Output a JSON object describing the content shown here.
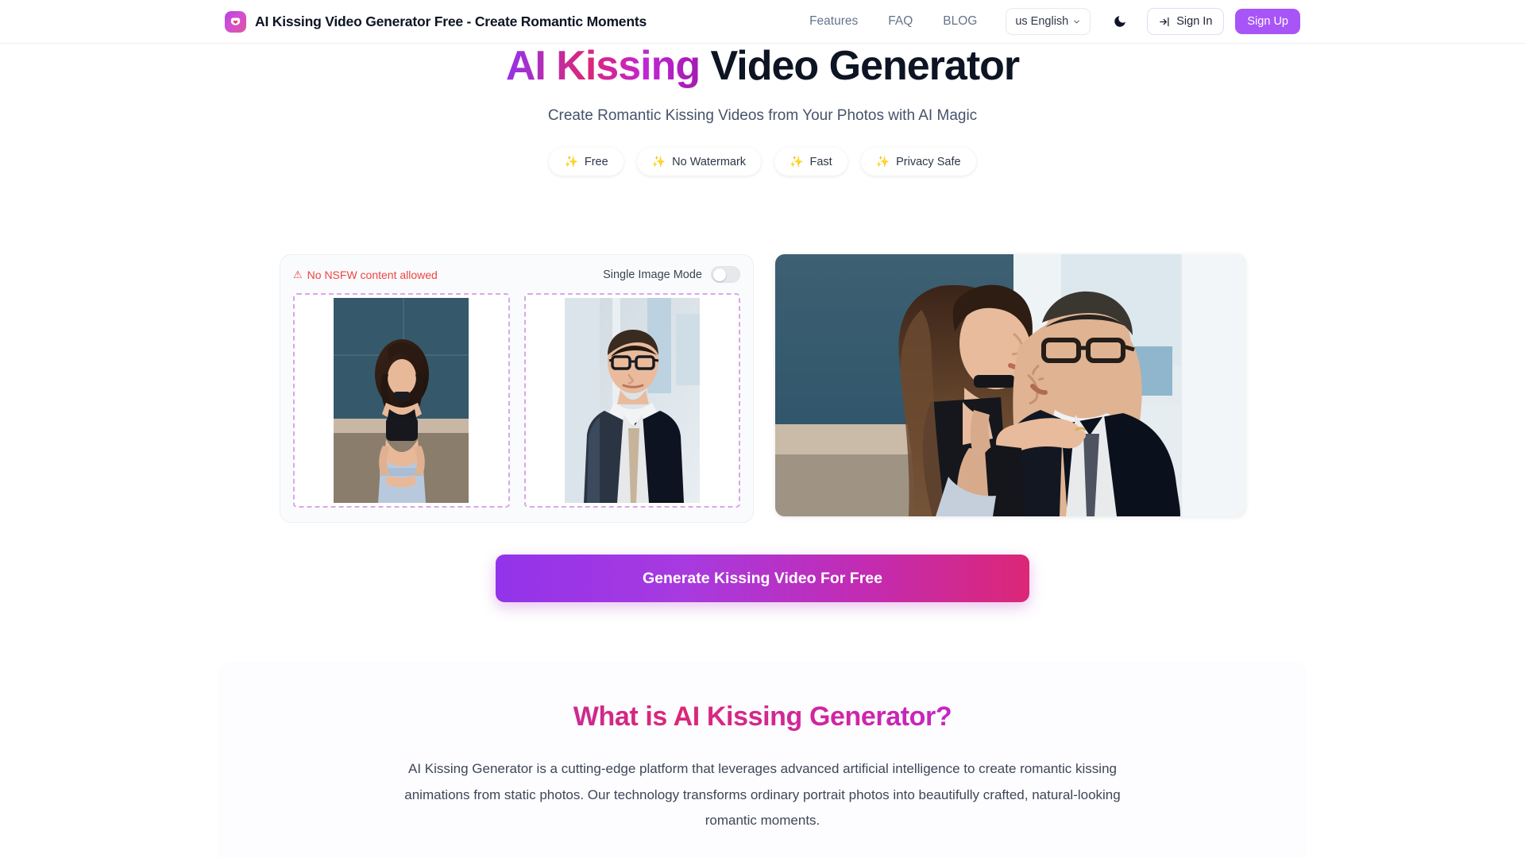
{
  "header": {
    "logo_icon": "kiss-logo-icon",
    "title": "AI Kissing Video Generator Free - Create Romantic Moments",
    "nav": [
      {
        "label": "Features",
        "name": "nav-link-features"
      },
      {
        "label": "FAQ",
        "name": "nav-link-faq"
      },
      {
        "label": "BLOG",
        "name": "nav-link-blog"
      }
    ],
    "language": {
      "label": "us English",
      "chevron_icon": "chevron-down-icon"
    },
    "theme_toggle_icon": "moon-icon",
    "sign_in": {
      "label": "Sign In",
      "icon": "login-arrow-icon"
    },
    "sign_up": {
      "label": "Sign Up"
    },
    "accent_color": "#a855f7"
  },
  "hero": {
    "title_gradient_part": "AI Kissing",
    "title_plain_part": "Video Generator",
    "subtitle": "Create Romantic Kissing Videos from Your Photos with AI Magic",
    "badges": [
      {
        "icon": "sparkles-icon",
        "glyph": "✨",
        "label": "Free"
      },
      {
        "icon": "sparkles-icon",
        "glyph": "✨",
        "label": "No Watermark"
      },
      {
        "icon": "sparkles-icon",
        "glyph": "✨",
        "label": "Fast"
      },
      {
        "icon": "sparkles-icon",
        "glyph": "✨",
        "label": "Privacy Safe"
      }
    ],
    "gradient_start": "#9333ea",
    "gradient_end": "#db2777"
  },
  "workspace": {
    "nsfw_warning": {
      "icon": "warning-triangle-icon",
      "glyph": "⚠",
      "text": "No NSFW content allowed",
      "color": "#ef4444"
    },
    "single_image_mode": {
      "label": "Single Image Mode",
      "state": "off"
    },
    "upload_slots": [
      {
        "name": "upload-slot-first",
        "filled": true,
        "subject": "woman-portrait-photo"
      },
      {
        "name": "upload-slot-second",
        "filled": true,
        "subject": "man-portrait-photo"
      }
    ],
    "result_preview": {
      "name": "result-preview-image",
      "subject": "kissing-couple-result"
    }
  },
  "cta": {
    "label": "Generate Kissing Video For Free",
    "gradient_start": "#9333ea",
    "gradient_end": "#db2777"
  },
  "about": {
    "title": "What is AI Kissing Generator?",
    "body": "AI Kissing Generator is a cutting-edge platform that leverages advanced artificial intelligence to create romantic kissing animations from static photos. Our technology transforms ordinary portrait photos into beautifully crafted, natural-looking romantic moments."
  }
}
